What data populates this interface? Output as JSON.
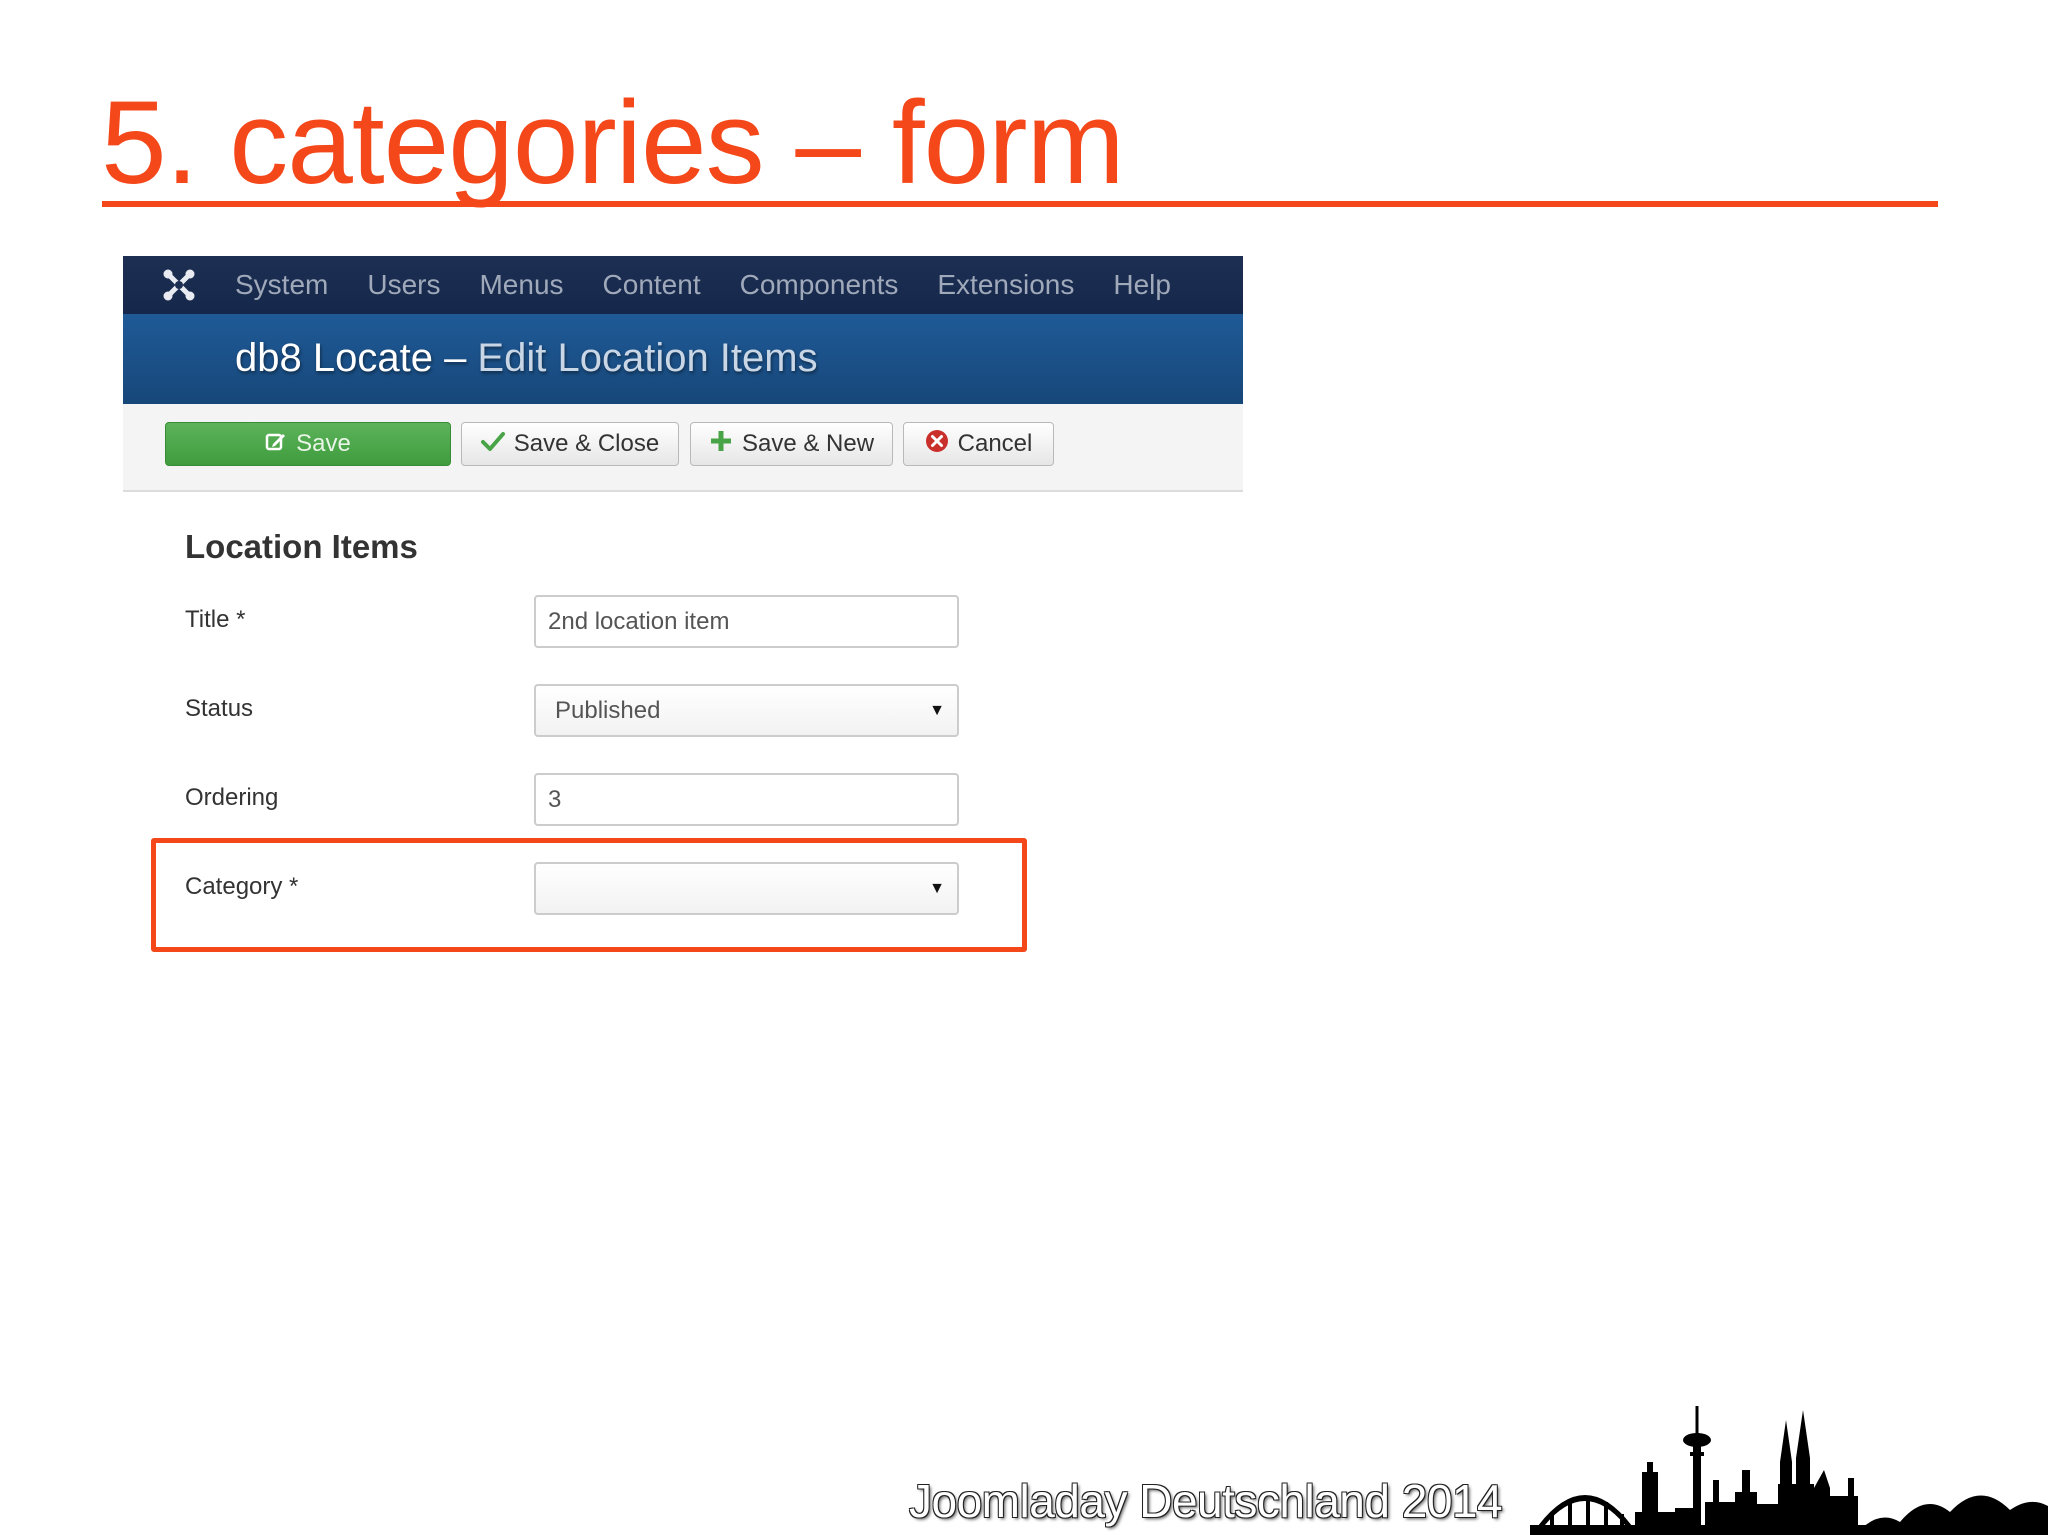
{
  "slide": {
    "title": "5. categories – form",
    "footer": "Joomladay Deutschland 2014"
  },
  "navbar": {
    "items": [
      "System",
      "Users",
      "Menus",
      "Content",
      "Components",
      "Extensions",
      "Help"
    ]
  },
  "header": {
    "title_part1": "db8 Locate – ",
    "title_part2": "Edit Location Items"
  },
  "toolbar": {
    "save_label": "Save",
    "save_close_label": "Save & Close",
    "save_new_label": "Save & New",
    "cancel_label": "Cancel"
  },
  "form": {
    "heading": "Location Items",
    "title_label": "Title *",
    "title_value": "2nd location item",
    "status_label": "Status",
    "status_value": "Published",
    "ordering_label": "Ordering",
    "ordering_value": "3",
    "category_label": "Category *",
    "category_value": ""
  },
  "colors": {
    "accent": "#f4471a",
    "navbar": "#1b2d50",
    "header": "#1c5189",
    "save_button": "#4ea94c"
  },
  "icons": {
    "logo": "joomla-logo",
    "save": "edit-icon",
    "save_close": "check-icon",
    "save_new": "plus-icon",
    "cancel": "cancel-circle-icon",
    "dropdown": "caret-down-icon"
  }
}
